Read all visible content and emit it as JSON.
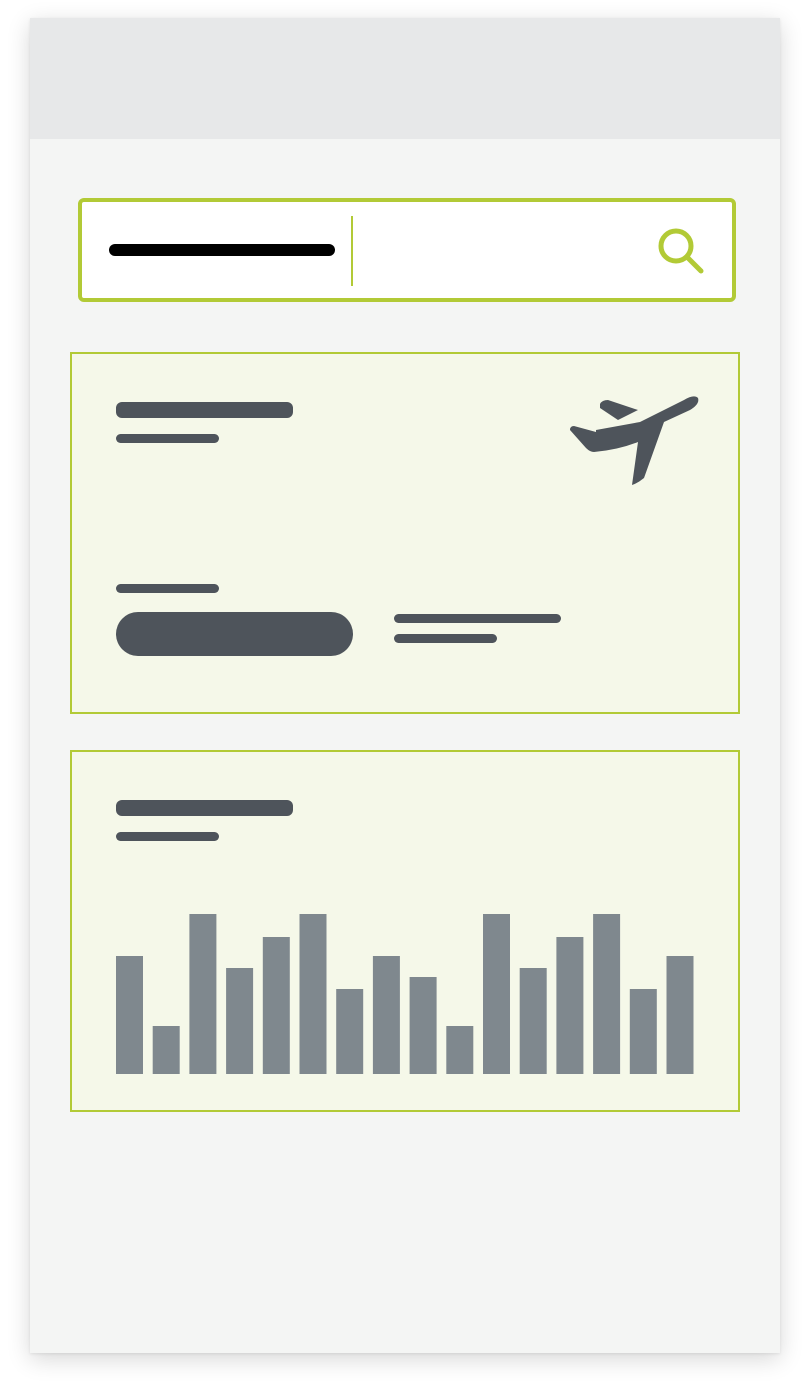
{
  "colors": {
    "accent": "#b2ca36",
    "surface": "#f4f5f4",
    "top_bar": "#e7e8e9",
    "card_background": "#f5f8e9",
    "placeholder_dark": "#4e545b",
    "chart_bar": "#7f888e",
    "search_text": "#000000"
  },
  "search": {
    "icon": "search-icon",
    "text": ""
  },
  "flight_card": {
    "icon": "airplane-icon"
  },
  "chart_card": {
    "chart_data": {
      "type": "bar",
      "values": [
        118,
        48,
        160,
        106,
        137,
        160,
        85,
        118,
        97,
        48,
        160,
        106,
        137,
        160,
        85,
        118
      ],
      "ylim": [
        0,
        160
      ],
      "grid": false,
      "color": "#7f888e"
    }
  }
}
